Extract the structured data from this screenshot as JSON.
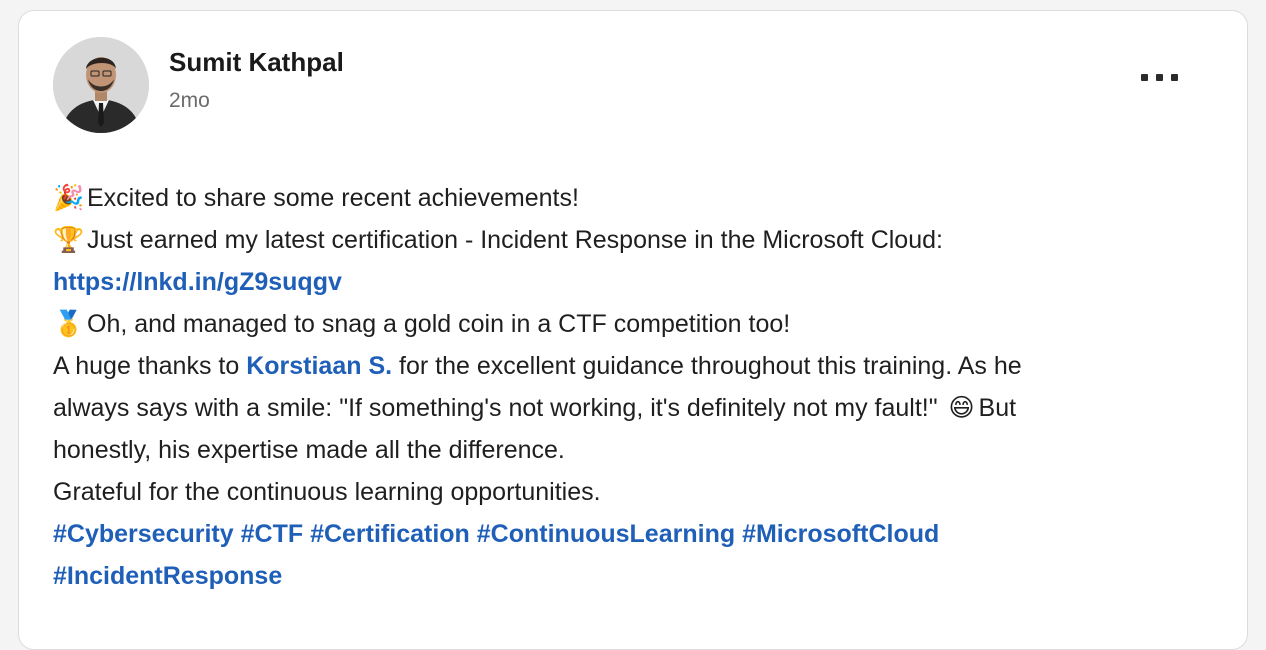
{
  "post": {
    "author": "Sumit Kathpal",
    "time": "2mo",
    "more_icon": "ellipsis-icon",
    "lines": {
      "l1_icon": "🎉",
      "l1_text": "Excited to share some recent achievements!",
      "l2_icon": "🏆",
      "l2_text": "Just earned my latest certification - Incident Response in the Microsoft Cloud:",
      "l3_link": "https://lnkd.in/gZ9suqgv",
      "l4_icon": "🥇",
      "l4_text": "Oh, and managed to snag a gold coin in a CTF competition too!",
      "l5_pre": "A huge thanks to ",
      "l5_mention": "Korstiaan S.",
      "l5_post": " for the excellent guidance throughout this training. As he",
      "l6_text": "always says with a smile: \"If something's not working, it's definitely not my fault!\"",
      "l6_emoji": "😄",
      "l6_post": "But",
      "l7_text": "honestly, his expertise made all the difference.",
      "l8_text": "Grateful for the continuous learning opportunities."
    },
    "hashtags_line1": [
      "#Cybersecurity",
      "#CTF",
      "#Certification",
      "#ContinuousLearning",
      "#MicrosoftCloud"
    ],
    "hashtags_line2": [
      "#IncidentResponse"
    ]
  },
  "colors": {
    "link": "#1f5fb8",
    "text": "#1f1f1f",
    "muted": "#6b6b6b"
  }
}
